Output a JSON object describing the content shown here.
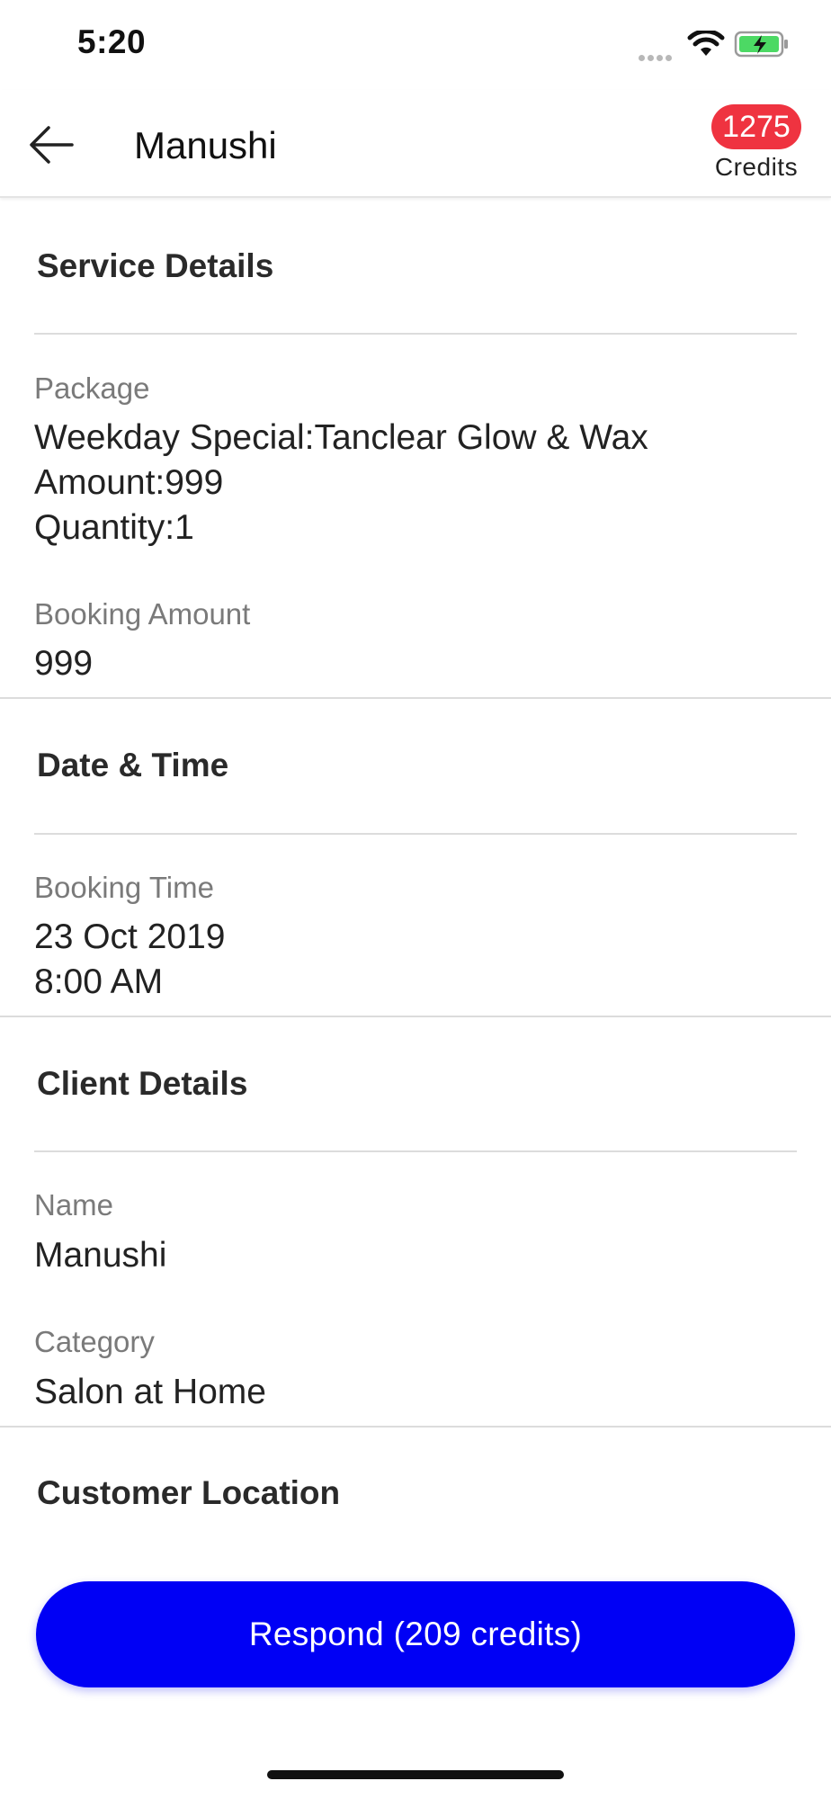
{
  "status": {
    "time": "5:20"
  },
  "header": {
    "title": "Manushi",
    "credits_count": "1275",
    "credits_label": "Credits"
  },
  "service": {
    "heading": "Service Details",
    "package_label": "Package",
    "package_name": "Weekday Special:Tanclear Glow & Wax",
    "package_amount": "Amount:999",
    "package_quantity": "Quantity:1",
    "amount_label": "Booking Amount",
    "amount_value": "999"
  },
  "datetime": {
    "heading": "Date & Time",
    "time_label": "Booking Time",
    "date_value": "23 Oct 2019",
    "time_value": "8:00 AM"
  },
  "client": {
    "heading": "Client Details",
    "name_label": "Name",
    "name_value": "Manushi",
    "category_label": "Category",
    "category_value": "Salon at Home"
  },
  "location": {
    "heading": "Customer Location"
  },
  "action": {
    "respond_label": "Respond (209 credits)"
  },
  "colors": {
    "accent": "#0000f5",
    "badge": "#ef3340",
    "battery": "#4cd964"
  }
}
